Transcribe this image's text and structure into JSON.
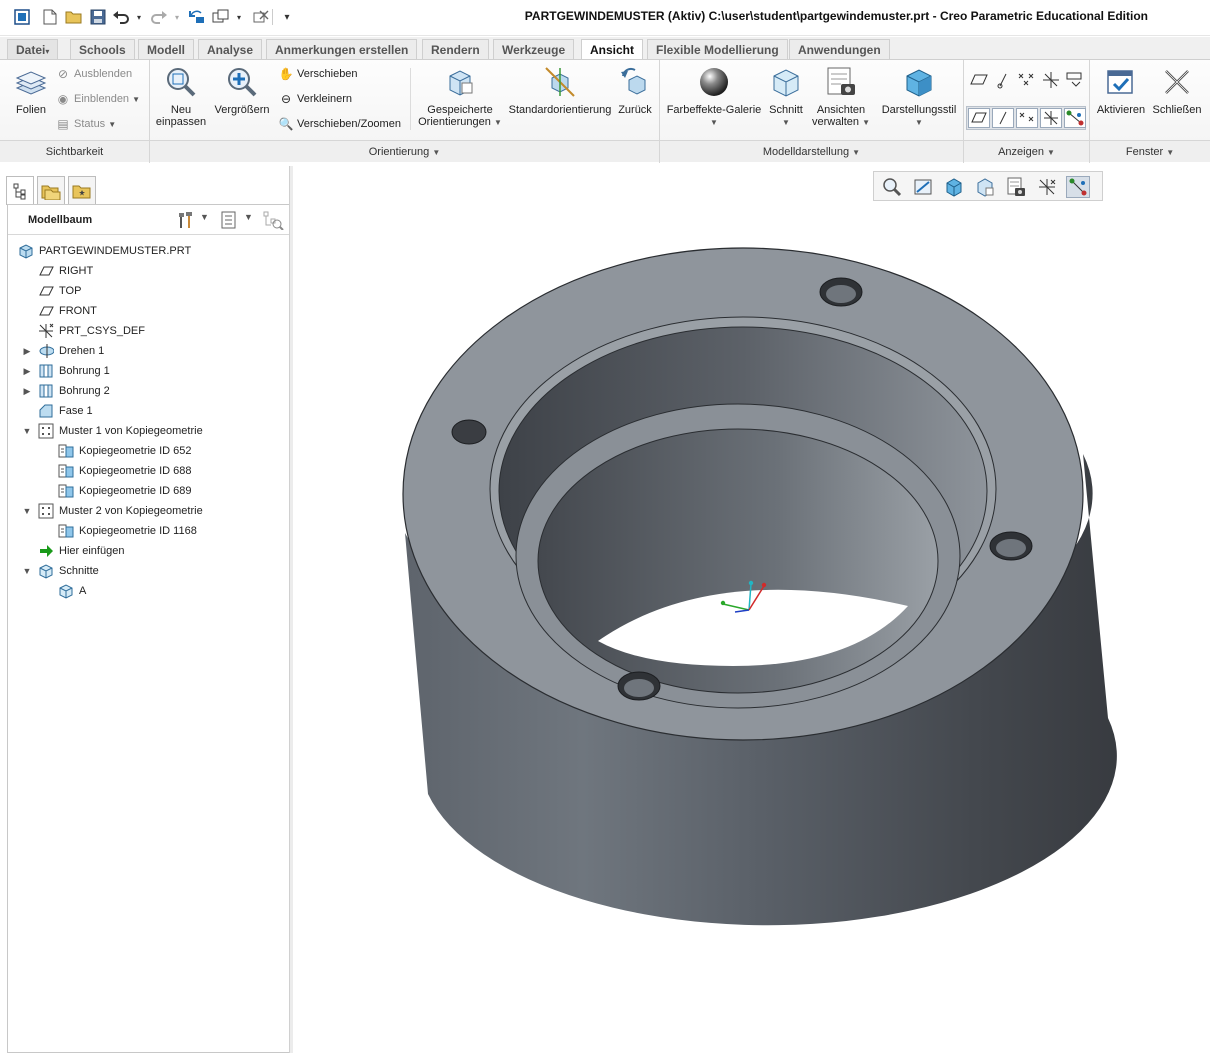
{
  "window": {
    "title": "PARTGEWINDEMUSTER (Aktiv) C:\\user\\student\\partgewindemuster.prt - Creo Parametric Educational Edition"
  },
  "quick_access": {
    "icons": [
      "app-icon",
      "new-icon",
      "open-icon",
      "save-icon",
      "undo-icon",
      "redo-icon",
      "regenerate-icon",
      "windows-icon",
      "close-window-icon",
      "customize-icon"
    ]
  },
  "tabs": [
    {
      "label": "Datei",
      "dropdown": "▾"
    },
    {
      "label": "Schools"
    },
    {
      "label": "Modell"
    },
    {
      "label": "Analyse"
    },
    {
      "label": "Anmerkungen erstellen"
    },
    {
      "label": "Rendern"
    },
    {
      "label": "Werkzeuge"
    },
    {
      "label": "Ansicht",
      "active": true
    },
    {
      "label": "Flexible Modellierung"
    },
    {
      "label": "Anwendungen"
    }
  ],
  "ribbon": {
    "sichtbarkeit": {
      "folien": "Folien",
      "ausblenden": "Ausblenden",
      "einblenden": "Einblenden",
      "status": "Status",
      "group": "Sichtbarkeit"
    },
    "orientierung": {
      "neu_einpassen_1": "Neu",
      "neu_einpassen_2": "einpassen",
      "vergroessern": "Vergrößern",
      "verschieben": "Verschieben",
      "verkleinern": "Verkleinern",
      "verschieben_zoomen": "Verschieben/Zoomen",
      "gespeicherte_1": "Gespeicherte",
      "gespeicherte_2": "Orientierungen",
      "standardorientierung": "Standardorientierung",
      "zurueck": "Zurück",
      "group": "Orientierung"
    },
    "modelldarstellung": {
      "farbeffekte": "Farbeffekte-Galerie",
      "schnitt": "Schnitt",
      "ansichten_1": "Ansichten",
      "ansichten_2": "verwalten",
      "darstellungsstil": "Darstellungsstil",
      "group": "Modelldarstellung"
    },
    "anzeigen": {
      "group": "Anzeigen"
    },
    "fenster": {
      "aktivieren": "Aktivieren",
      "schliessen": "Schließen",
      "group": "Fenster"
    }
  },
  "model_tree": {
    "title": "Modellbaum",
    "rows": [
      {
        "label": "PARTGEWINDEMUSTER.PRT",
        "icon": "part-icon",
        "level": 0,
        "expander": ""
      },
      {
        "label": "RIGHT",
        "icon": "datum-plane-icon",
        "level": 1,
        "expander": ""
      },
      {
        "label": "TOP",
        "icon": "datum-plane-icon",
        "level": 1,
        "expander": ""
      },
      {
        "label": "FRONT",
        "icon": "datum-plane-icon",
        "level": 1,
        "expander": ""
      },
      {
        "label": "PRT_CSYS_DEF",
        "icon": "csys-icon",
        "level": 1,
        "expander": ""
      },
      {
        "label": "Drehen 1",
        "icon": "revolve-icon",
        "level": 1,
        "expander": "▶"
      },
      {
        "label": "Bohrung 1",
        "icon": "hole-icon",
        "level": 1,
        "expander": "▶"
      },
      {
        "label": "Bohrung 2",
        "icon": "hole-icon",
        "level": 1,
        "expander": "▶"
      },
      {
        "label": "Fase 1",
        "icon": "chamfer-icon",
        "level": 1,
        "expander": ""
      },
      {
        "label": "Muster 1 von Kopiegeometrie",
        "icon": "pattern-icon",
        "level": 1,
        "expander": "▼"
      },
      {
        "label": "Kopiegeometrie ID 652",
        "icon": "copy-geom-icon",
        "level": 2,
        "expander": ""
      },
      {
        "label": "Kopiegeometrie ID 688",
        "icon": "copy-geom-icon",
        "level": 2,
        "expander": ""
      },
      {
        "label": "Kopiegeometrie ID 689",
        "icon": "copy-geom-icon",
        "level": 2,
        "expander": ""
      },
      {
        "label": "Muster 2 von Kopiegeometrie",
        "icon": "pattern-icon",
        "level": 1,
        "expander": "▼"
      },
      {
        "label": "Kopiegeometrie ID 1168",
        "icon": "copy-geom-icon",
        "level": 2,
        "expander": ""
      },
      {
        "label": "Hier einfügen",
        "icon": "insert-here-icon",
        "level": 1,
        "expander": ""
      },
      {
        "label": "Schnitte",
        "icon": "section-icon",
        "level": 1,
        "expander": "▼"
      },
      {
        "label": "A",
        "icon": "section-icon",
        "level": 2,
        "expander": ""
      }
    ]
  },
  "colors": {
    "accent_blue": "#1e6fb8",
    "model_grey": "#7c838b",
    "insert_green": "#1a9a1a"
  }
}
